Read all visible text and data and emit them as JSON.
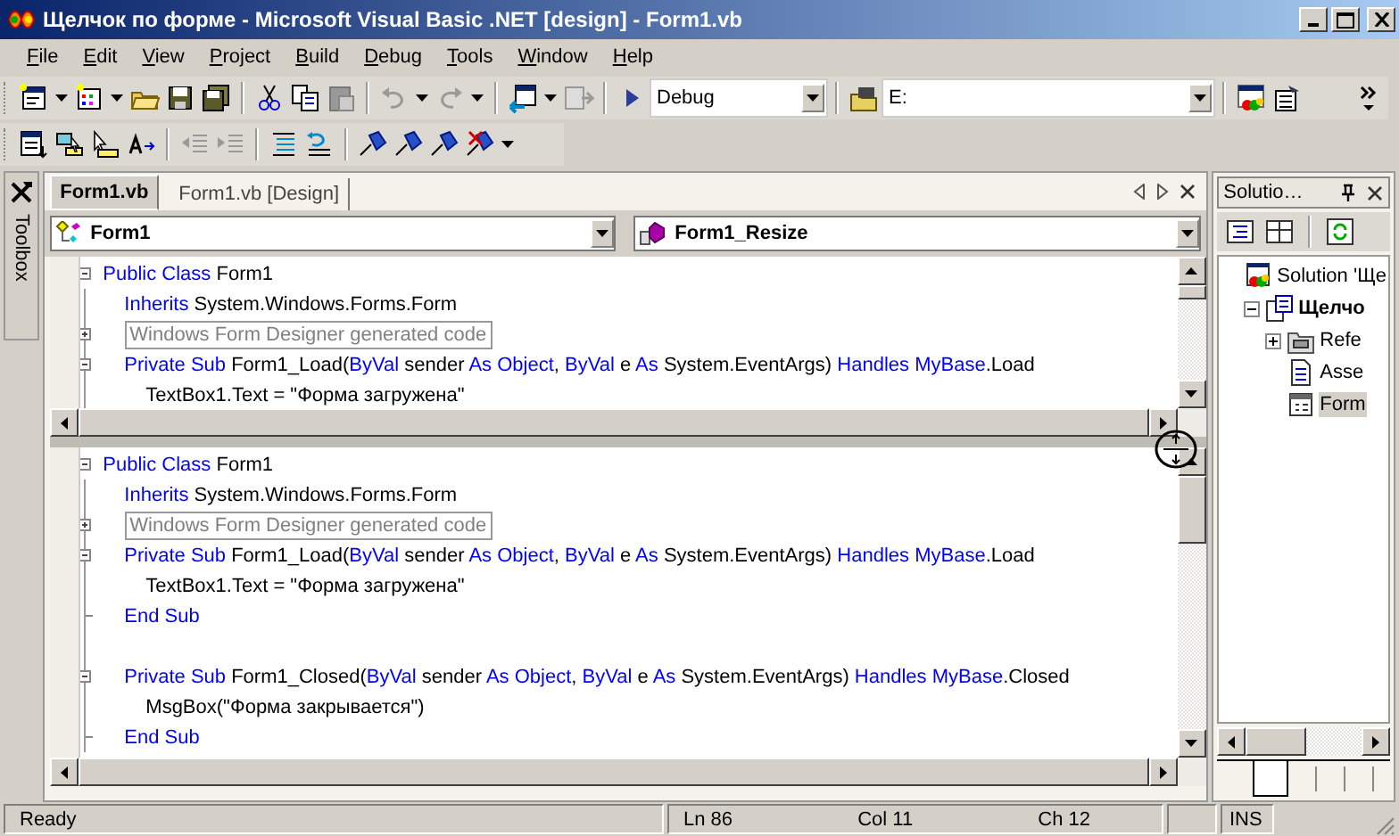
{
  "window": {
    "title": "Щелчок по форме - Microsoft Visual Basic .NET [design] - Form1.vb"
  },
  "menu": [
    "File",
    "Edit",
    "View",
    "Project",
    "Build",
    "Debug",
    "Tools",
    "Window",
    "Help"
  ],
  "toolbar": {
    "configuration": "Debug",
    "find": "E:"
  },
  "toolbox": {
    "label": "Toolbox"
  },
  "editor": {
    "tabs": [
      {
        "label": "Form1.vb",
        "selected": true
      },
      {
        "label": "Form1.vb [Design]",
        "selected": false
      }
    ],
    "class_combo": "Form1",
    "method_combo": "Form1_Resize",
    "top_pane": {
      "lines": [
        {
          "kind": "block",
          "tokens": [
            {
              "kind": "keyword",
              "text": "Public Class"
            },
            {
              "kind": "text",
              "text": " Form1"
            }
          ],
          "children": [
            {
              "kind": "statement",
              "tokens": [
                {
                  "kind": "keyword",
                  "text": "Inherits"
                },
                {
                  "kind": "text",
                  "text": " System.Windows.Forms.Form"
                }
              ]
            },
            {
              "kind": "region",
              "text": "Windows Form Designer generated code"
            },
            {
              "kind": "block",
              "tokens": [
                {
                  "kind": "keyword",
                  "text": "Private Sub"
                },
                {
                  "kind": "text",
                  "text": " Form1_Load("
                },
                {
                  "kind": "keyword",
                  "text": "ByVal"
                },
                {
                  "kind": "text",
                  "text": " sender "
                },
                {
                  "kind": "keyword",
                  "text": "As Object"
                },
                {
                  "kind": "text",
                  "text": ", "
                },
                {
                  "kind": "keyword",
                  "text": "ByVal"
                },
                {
                  "kind": "text",
                  "text": " e "
                },
                {
                  "kind": "keyword",
                  "text": "As"
                },
                {
                  "kind": "text",
                  "text": " System.EventArgs) "
                },
                {
                  "kind": "keyword",
                  "text": "Handles MyBase"
                },
                {
                  "kind": "text",
                  "text": ".Load"
                }
              ],
              "children": [
                {
                  "kind": "statement",
                  "tokens": [
                    {
                      "kind": "text",
                      "text": "TextBox1.Text = \"Форма загружена\""
                    }
                  ]
                }
              ]
            }
          ]
        }
      ]
    },
    "bottom_pane": {
      "lines": [
        {
          "kind": "block",
          "tokens": [
            {
              "kind": "keyword",
              "text": "Public Class"
            },
            {
              "kind": "text",
              "text": " Form1"
            }
          ],
          "children": [
            {
              "kind": "statement",
              "tokens": [
                {
                  "kind": "keyword",
                  "text": "Inherits"
                },
                {
                  "kind": "text",
                  "text": " System.Windows.Forms.Form"
                }
              ]
            },
            {
              "kind": "region",
              "text": "Windows Form Designer generated code"
            },
            {
              "kind": "block",
              "tokens": [
                {
                  "kind": "keyword",
                  "text": "Private Sub"
                },
                {
                  "kind": "text",
                  "text": " Form1_Load("
                },
                {
                  "kind": "keyword",
                  "text": "ByVal"
                },
                {
                  "kind": "text",
                  "text": " sender "
                },
                {
                  "kind": "keyword",
                  "text": "As Object"
                },
                {
                  "kind": "text",
                  "text": ", "
                },
                {
                  "kind": "keyword",
                  "text": "ByVal"
                },
                {
                  "kind": "text",
                  "text": " e "
                },
                {
                  "kind": "keyword",
                  "text": "As"
                },
                {
                  "kind": "text",
                  "text": " System.EventArgs) "
                },
                {
                  "kind": "keyword",
                  "text": "Handles MyBase"
                },
                {
                  "kind": "text",
                  "text": ".Load"
                }
              ],
              "children": [
                {
                  "kind": "statement",
                  "tokens": [
                    {
                      "kind": "text",
                      "text": "TextBox1.Text = \"Форма загружена\""
                    }
                  ]
                }
              ]
            },
            {
              "kind": "end",
              "tokens": [
                {
                  "kind": "keyword",
                  "text": "End Sub"
                }
              ]
            },
            {
              "kind": "blank"
            },
            {
              "kind": "block",
              "tokens": [
                {
                  "kind": "keyword",
                  "text": "Private Sub"
                },
                {
                  "kind": "text",
                  "text": " Form1_Closed("
                },
                {
                  "kind": "keyword",
                  "text": "ByVal"
                },
                {
                  "kind": "text",
                  "text": " sender "
                },
                {
                  "kind": "keyword",
                  "text": "As Object"
                },
                {
                  "kind": "text",
                  "text": ", "
                },
                {
                  "kind": "keyword",
                  "text": "ByVal"
                },
                {
                  "kind": "text",
                  "text": " e "
                },
                {
                  "kind": "keyword",
                  "text": "As"
                },
                {
                  "kind": "text",
                  "text": " System.EventArgs) "
                },
                {
                  "kind": "keyword",
                  "text": "Handles MyBase"
                },
                {
                  "kind": "text",
                  "text": ".Closed"
                }
              ],
              "children": [
                {
                  "kind": "statement",
                  "tokens": [
                    {
                      "kind": "text",
                      "text": "MsgBox(\"Форма закрывается\")"
                    }
                  ]
                }
              ]
            },
            {
              "kind": "end",
              "tokens": [
                {
                  "kind": "keyword",
                  "text": "End Sub"
                }
              ]
            }
          ]
        }
      ]
    }
  },
  "solution_explorer": {
    "title": "Solutio…",
    "tree": [
      {
        "label": "Solution 'Ще",
        "kind": "solution",
        "selected": false,
        "children": [
          {
            "label": "Щелчо",
            "kind": "project",
            "selected": false,
            "expanded": true,
            "children": [
              {
                "label": "Refe",
                "kind": "references",
                "selected": false,
                "expanded": false
              },
              {
                "label": "Asse",
                "kind": "vbfile",
                "selected": false
              },
              {
                "label": "Form",
                "kind": "form",
                "selected": true
              }
            ]
          }
        ]
      }
    ]
  },
  "status_bar": {
    "message": "Ready",
    "line": "Ln 86",
    "column": "Col 11",
    "char": "Ch 12",
    "mode": "INS"
  }
}
